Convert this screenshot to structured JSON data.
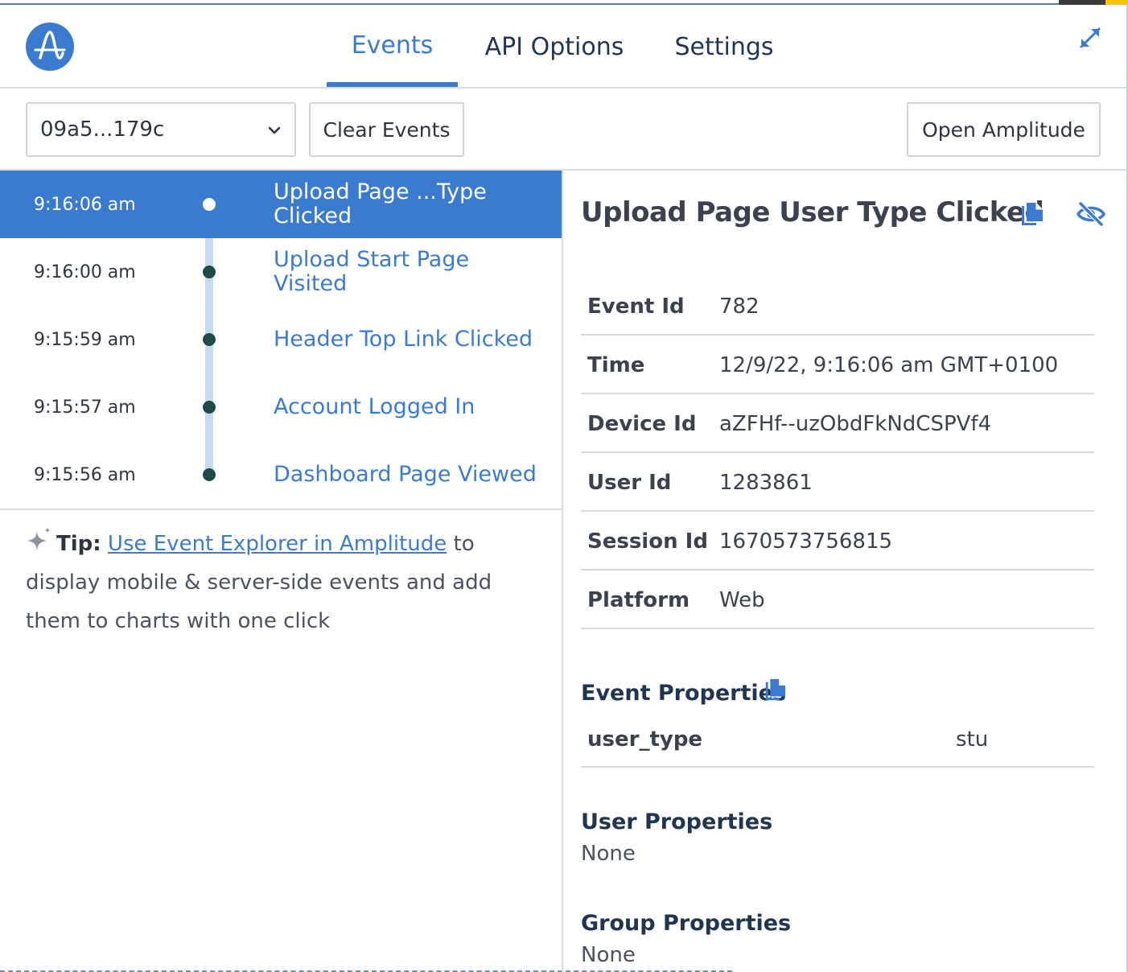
{
  "header": {
    "tabs": [
      {
        "label": "Events",
        "active": true
      },
      {
        "label": "API Options",
        "active": false
      },
      {
        "label": "Settings",
        "active": false
      }
    ]
  },
  "toolbar": {
    "device_value": "09a5...179c",
    "clear_label": "Clear Events",
    "open_label": "Open Amplitude"
  },
  "events": [
    {
      "time": "9:16:06 am",
      "name": "Upload Page ...Type Clicked",
      "selected": true
    },
    {
      "time": "9:16:00 am",
      "name": "Upload Start Page Visited",
      "selected": false
    },
    {
      "time": "9:15:59 am",
      "name": "Header Top Link Clicked",
      "selected": false
    },
    {
      "time": "9:15:57 am",
      "name": "Account Logged In",
      "selected": false
    },
    {
      "time": "9:15:56 am",
      "name": "Dashboard Page Viewed",
      "selected": false
    }
  ],
  "tip": {
    "label": "Tip:",
    "link": "Use Event Explorer in Amplitude",
    "text": " to display mobile & server-side events and add them to charts with one click"
  },
  "detail": {
    "title": "Upload Page User Type Clicked",
    "fields": [
      {
        "key": "Event Id",
        "value": "782"
      },
      {
        "key": "Time",
        "value": "12/9/22, 9:16:06 am GMT+0100"
      },
      {
        "key": "Device Id",
        "value": "aZFHf--uzObdFkNdCSPVf4"
      },
      {
        "key": "User Id",
        "value": "1283861"
      },
      {
        "key": "Session Id",
        "value": "1670573756815"
      },
      {
        "key": "Platform",
        "value": "Web"
      }
    ],
    "event_properties": {
      "title": "Event Properties",
      "items": [
        {
          "key": "user_type",
          "value": "stu"
        }
      ]
    },
    "user_properties": {
      "title": "User Properties",
      "value": "None"
    },
    "group_properties": {
      "title": "Group Properties",
      "value": "None"
    }
  },
  "colors": {
    "accent": "#3a7bd0",
    "timeline": "#c3dcf2",
    "dot": "#1e4a4a",
    "border": "#d6dbe2"
  },
  "icons": {
    "logo": "amplitude-logo",
    "expand": "expand-icon",
    "chevron": "chevron-down-icon",
    "sparkle": "sparkle-icon",
    "copy": "copy-icon",
    "hide": "eye-off-icon"
  }
}
